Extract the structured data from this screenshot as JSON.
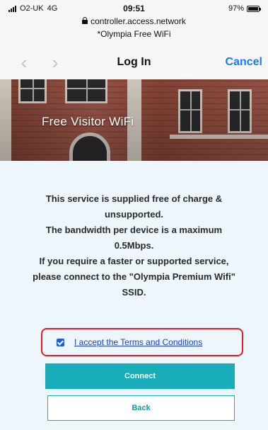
{
  "status_bar": {
    "carrier": "O2-UK",
    "network": "4G",
    "time": "09:51",
    "battery": "97%",
    "battery_level": 0.97
  },
  "browser": {
    "url": "controller.access.network",
    "page_label": "*Olympia Free WiFi",
    "title": "Log In",
    "cancel_label": "Cancel",
    "back_arrow": "‹",
    "forward_arrow": "›"
  },
  "banner": {
    "title": "Free Visitor WiFi"
  },
  "notice": {
    "lines": [
      "This service is supplied free of charge &",
      "unsupported.",
      "The bandwidth per device is a maximum",
      "0.5Mbps.",
      "If you require a faster or supported service,",
      "please connect to the \"Olympia Premium Wifi\"",
      "SSID."
    ]
  },
  "terms": {
    "label": "I accept the Terms and Conditions",
    "checked": true
  },
  "buttons": {
    "connect": "Connect",
    "back": "Back"
  },
  "colors": {
    "accent": "#19acb9",
    "link": "#1a3fd0",
    "ios_blue": "#1a7df2",
    "highlight_border": "#e11d2b",
    "content_bg": "#edf6fb"
  }
}
